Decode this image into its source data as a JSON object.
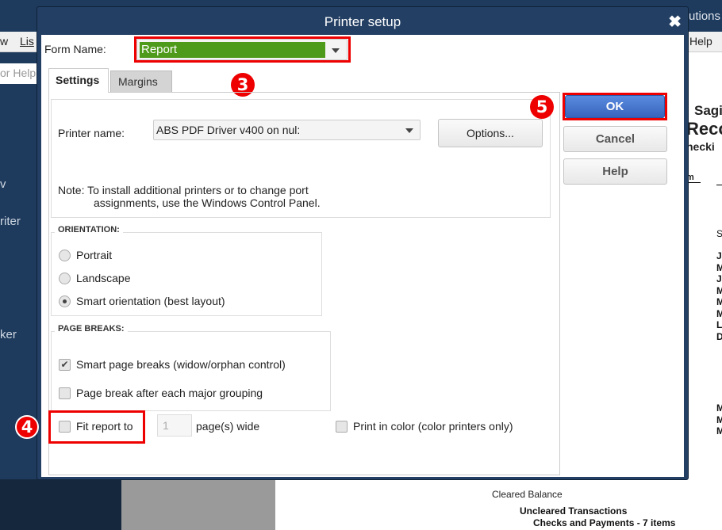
{
  "background": {
    "app_title_fragment": "utions",
    "menu_fragments": [
      "w",
      "Lis",
      "Help"
    ],
    "search_placeholder_fragment": "or Help",
    "sidebar_fragments": [
      "v",
      "riter",
      "ker"
    ],
    "report": {
      "company_fragment": "Sagi",
      "title_fragment": "Reco",
      "account_fragment": "hecki",
      "column_fragment": "m",
      "row_initials": [
        "S",
        "J",
        "M",
        "J",
        "M",
        "M",
        "M",
        "L",
        "D",
        "M",
        "M",
        "M"
      ],
      "cleared_balance": "Cleared Balance",
      "uncleared_transactions": "Uncleared Transactions",
      "checks_payments": "Checks and Payments - 7 items"
    }
  },
  "dialog": {
    "title": "Printer setup",
    "close_icon": "close-x",
    "form_name_label": "Form Name:",
    "form_name_value": "Report",
    "form_name_highlight": "#4e9a1a",
    "tabs": [
      {
        "label": "Settings",
        "active": true
      },
      {
        "label": "Margins",
        "active": false
      }
    ],
    "printer_name_label": "Printer name:",
    "printer_name_value": "ABS PDF Driver v400 on nul:",
    "options_button": "Options...",
    "note_line1": "Note: To install additional printers or to change port",
    "note_line2": "assignments, use the Windows Control Panel.",
    "orientation": {
      "title": "ORIENTATION:",
      "options": [
        {
          "label": "Portrait",
          "selected": false
        },
        {
          "label": "Landscape",
          "selected": false
        },
        {
          "label": "Smart orientation (best layout)",
          "selected": true
        }
      ]
    },
    "page_breaks": {
      "title": "PAGE BREAKS:",
      "options": [
        {
          "label": "Smart page breaks (widow/orphan control)",
          "checked": true
        },
        {
          "label": "Page break after each major grouping",
          "checked": false
        }
      ]
    },
    "fit_report_label": "Fit report to",
    "fit_report_checked": false,
    "fit_pages_value": "1",
    "fit_pages_suffix": "page(s) wide",
    "print_color_label": "Print in color (color printers only)",
    "print_color_checked": false,
    "buttons": {
      "ok": "OK",
      "cancel": "Cancel",
      "help": "Help"
    },
    "ok_color": "#3f73c8"
  },
  "annotations": {
    "step3": "3",
    "step4": "4",
    "step5": "5",
    "highlight_color": "#e00000"
  }
}
